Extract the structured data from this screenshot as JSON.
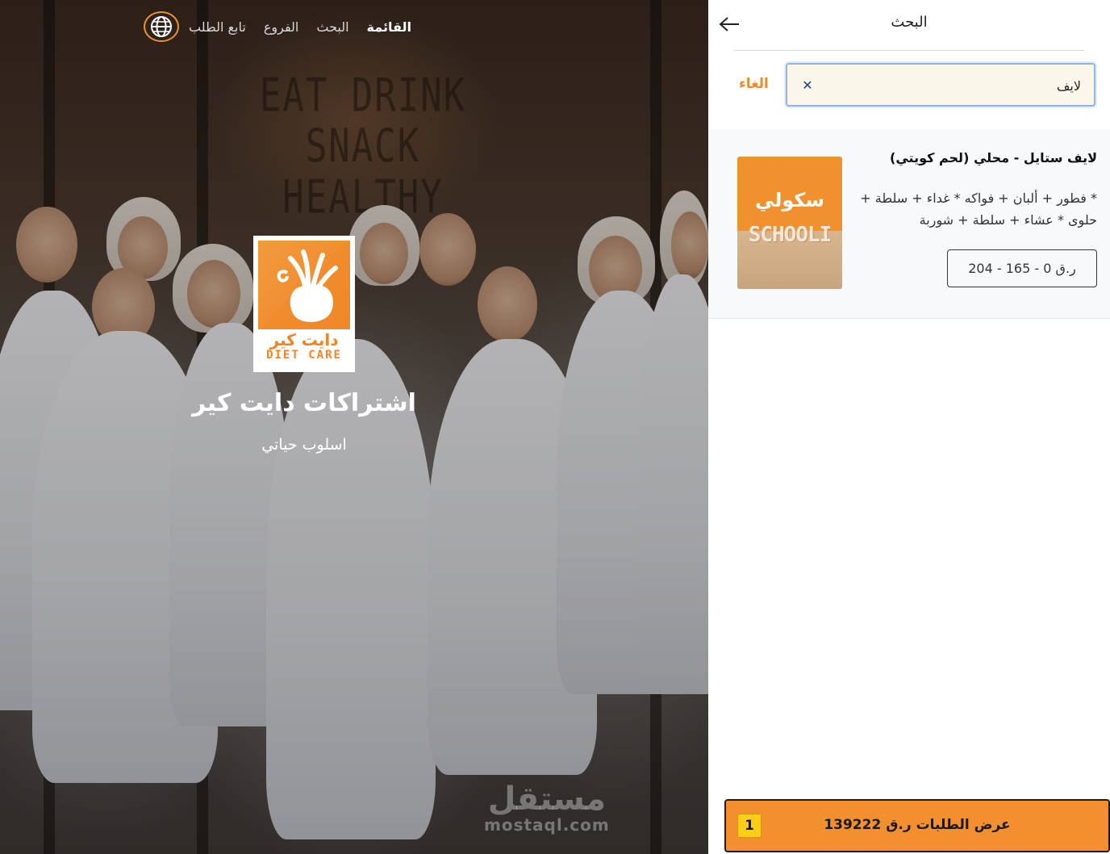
{
  "nav": {
    "items": [
      {
        "label": "القائمة",
        "active": true
      },
      {
        "label": "البحث",
        "active": false
      },
      {
        "label": "الفروع",
        "active": false
      },
      {
        "label": "تابع الطلب",
        "active": false
      }
    ],
    "language_icon": "globe-icon"
  },
  "hero": {
    "title": "اشتراكات دايت كير",
    "subtitle": "اسلوب حياتي",
    "logo": {
      "ar": "دايت كير",
      "en": "DIET CARE"
    },
    "background_wall_text": "EAT DRINK SNACK HEALTHY",
    "watermark": {
      "ar": "مستقل",
      "en": "mostaql.com"
    }
  },
  "panel": {
    "title": "البحث",
    "back_icon": "arrow-left-icon",
    "cancel_label": "الغاء",
    "search": {
      "value": "لايف",
      "placeholder": ""
    },
    "clear_icon": "close-icon",
    "results": [
      {
        "title": "لايف ستايل - محلي (لحم كويتي)",
        "description": "* فطور + ألبان + فواكه * غداء + سلطة + حلوى * عشاء + سلطة + شوربة",
        "price": "ر.ق 0 - 165 - 204",
        "image": {
          "ar": "سكولي",
          "en": "SCHOOLI"
        }
      }
    ]
  },
  "orders_bar": {
    "label": "عرض الطلبات ر.ق 139222",
    "count": "1"
  },
  "colors": {
    "accent": "#f2902f",
    "badge": "#ffcc18",
    "search_bg": "#faf6ea",
    "search_border": "#8fb4e6"
  }
}
